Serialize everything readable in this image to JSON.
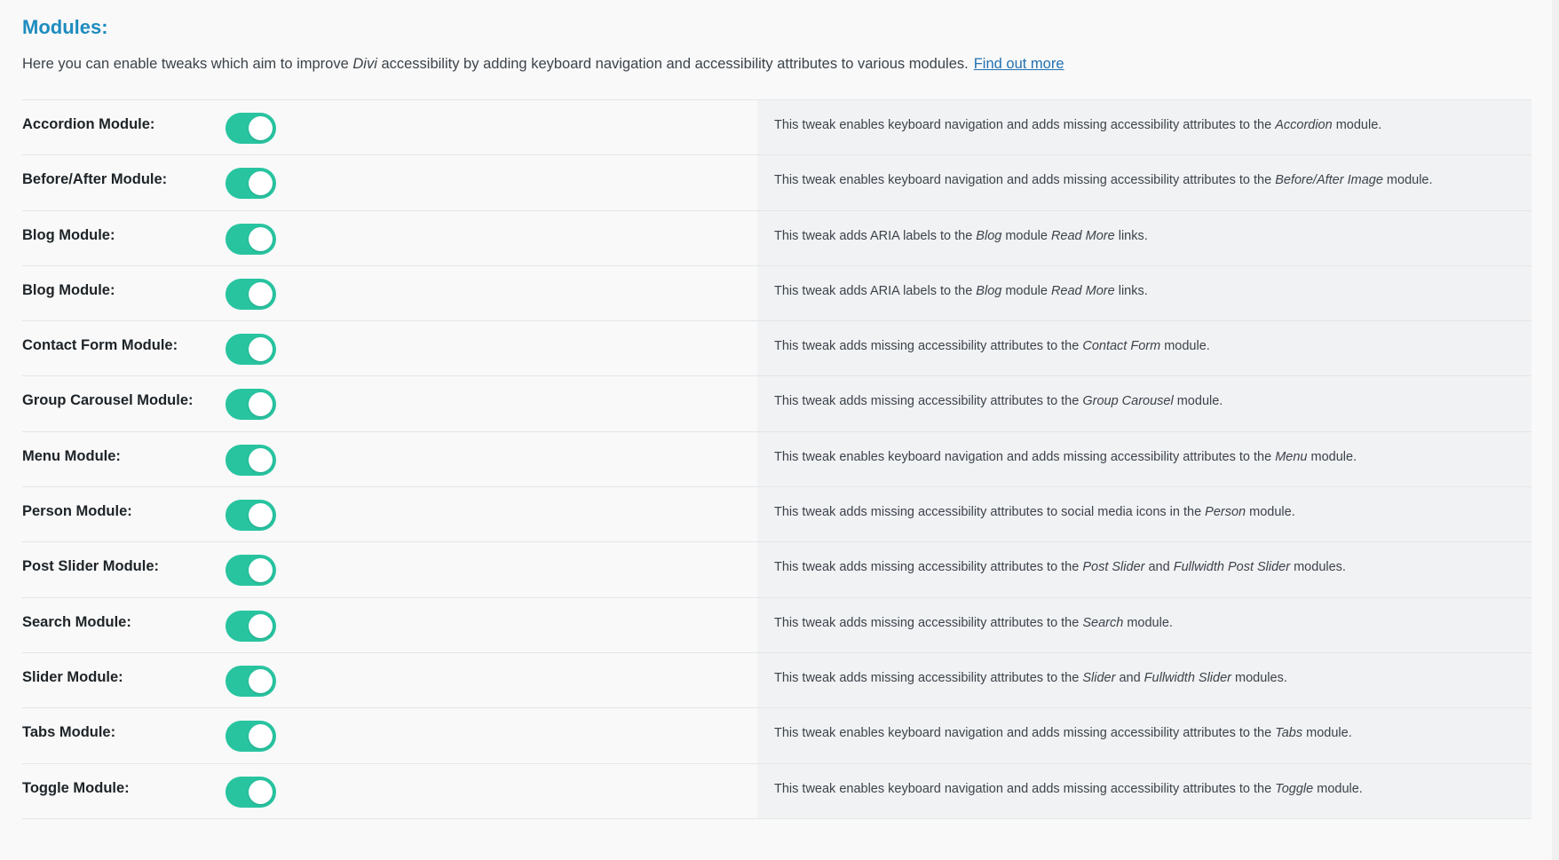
{
  "header": {
    "title": "Modules:",
    "intro_before": "Here you can enable tweaks which aim to improve ",
    "intro_em": "Divi",
    "intro_after": " accessibility by adding keyboard navigation and accessibility attributes to various modules.",
    "link_label": "Find out more"
  },
  "colors": {
    "accent": "#1e8cbe",
    "toggle_on": "#28c4a0",
    "link": "#2271b1"
  },
  "modules": [
    {
      "label": "Accordion Module:",
      "enabled": true,
      "desc": [
        {
          "t": "This tweak enables keyboard navigation and adds missing accessibility attributes to the "
        },
        {
          "t": "Accordion",
          "em": true
        },
        {
          "t": " module."
        }
      ]
    },
    {
      "label": "Before/After Module:",
      "enabled": true,
      "desc": [
        {
          "t": "This tweak enables keyboard navigation and adds missing accessibility attributes to the "
        },
        {
          "t": "Before/After Image",
          "em": true
        },
        {
          "t": " module."
        }
      ]
    },
    {
      "label": "Blog Module:",
      "enabled": true,
      "desc": [
        {
          "t": "This tweak adds ARIA labels to the "
        },
        {
          "t": "Blog",
          "em": true
        },
        {
          "t": " module "
        },
        {
          "t": "Read More",
          "em": true
        },
        {
          "t": " links."
        }
      ]
    },
    {
      "label": "Blog Module:",
      "enabled": true,
      "desc": [
        {
          "t": "This tweak adds ARIA labels to the "
        },
        {
          "t": "Blog",
          "em": true
        },
        {
          "t": " module "
        },
        {
          "t": "Read More",
          "em": true
        },
        {
          "t": " links."
        }
      ]
    },
    {
      "label": "Contact Form Module:",
      "enabled": true,
      "desc": [
        {
          "t": "This tweak adds missing accessibility attributes to the "
        },
        {
          "t": "Contact Form",
          "em": true
        },
        {
          "t": " module."
        }
      ]
    },
    {
      "label": "Group Carousel Module:",
      "enabled": true,
      "desc": [
        {
          "t": "This tweak adds missing accessibility attributes to the "
        },
        {
          "t": "Group Carousel",
          "em": true
        },
        {
          "t": " module."
        }
      ]
    },
    {
      "label": "Menu Module:",
      "enabled": true,
      "desc": [
        {
          "t": "This tweak enables keyboard navigation and adds missing accessibility attributes to the "
        },
        {
          "t": "Menu",
          "em": true
        },
        {
          "t": " module."
        }
      ]
    },
    {
      "label": "Person Module:",
      "enabled": true,
      "desc": [
        {
          "t": "This tweak adds missing accessibility attributes to social media icons in the "
        },
        {
          "t": "Person",
          "em": true
        },
        {
          "t": " module."
        }
      ]
    },
    {
      "label": "Post Slider Module:",
      "enabled": true,
      "desc": [
        {
          "t": "This tweak adds missing accessibility attributes to the "
        },
        {
          "t": "Post Slider",
          "em": true
        },
        {
          "t": " and "
        },
        {
          "t": "Fullwidth Post Slider",
          "em": true
        },
        {
          "t": " modules."
        }
      ]
    },
    {
      "label": "Search Module:",
      "enabled": true,
      "desc": [
        {
          "t": "This tweak adds missing accessibility attributes to the "
        },
        {
          "t": "Search",
          "em": true
        },
        {
          "t": " module."
        }
      ]
    },
    {
      "label": "Slider Module:",
      "enabled": true,
      "desc": [
        {
          "t": "This tweak adds missing accessibility attributes to the "
        },
        {
          "t": "Slider",
          "em": true
        },
        {
          "t": " and "
        },
        {
          "t": "Fullwidth Slider",
          "em": true
        },
        {
          "t": " modules."
        }
      ]
    },
    {
      "label": "Tabs Module:",
      "enabled": true,
      "desc": [
        {
          "t": "This tweak enables keyboard navigation and adds missing accessibility attributes to the "
        },
        {
          "t": "Tabs",
          "em": true
        },
        {
          "t": " module."
        }
      ]
    },
    {
      "label": "Toggle Module:",
      "enabled": true,
      "desc": [
        {
          "t": "This tweak enables keyboard navigation and adds missing accessibility attributes to the "
        },
        {
          "t": "Toggle",
          "em": true
        },
        {
          "t": " module."
        }
      ]
    }
  ]
}
